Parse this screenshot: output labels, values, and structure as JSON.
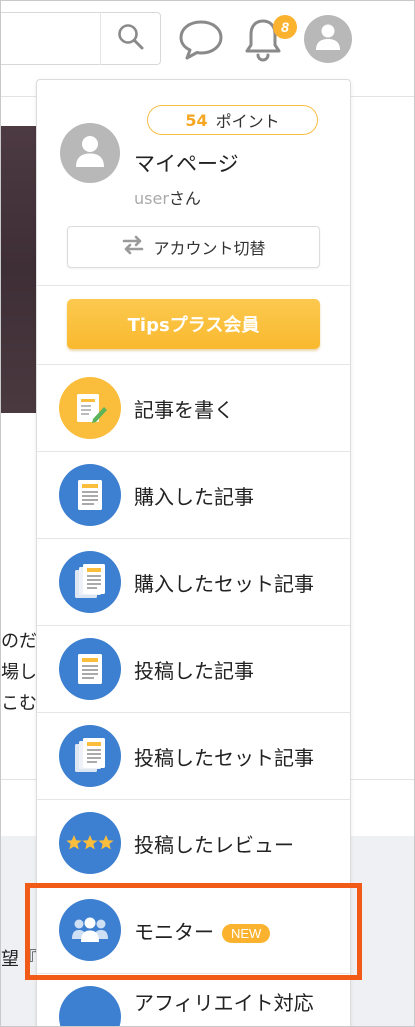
{
  "header": {
    "search_icon": "search-icon",
    "chat_icon": "chat-bubble-icon",
    "bell_icon": "bell-icon",
    "notification_count": "8",
    "avatar_icon": "user-avatar-icon"
  },
  "background": {
    "text_lines": [
      "のだ",
      "場しま",
      "こむ",
      "望『"
    ]
  },
  "dropdown": {
    "points_value": "54",
    "points_label": "ポイント",
    "mypage_label": "マイページ",
    "username": "user",
    "username_suffix": "さん",
    "switch_account_label": "アカウント切替",
    "tips_plus_label": "Tipsプラス会員",
    "menu": [
      {
        "label": "記事を書く",
        "icon": "write-article-icon",
        "color": "#fbbd3c"
      },
      {
        "label": "購入した記事",
        "icon": "document-icon",
        "color": "#3d7fd0"
      },
      {
        "label": "購入したセット記事",
        "icon": "document-set-icon",
        "color": "#3d7fd0"
      },
      {
        "label": "投稿した記事",
        "icon": "document-icon",
        "color": "#3d7fd0"
      },
      {
        "label": "投稿したセット記事",
        "icon": "document-set-icon",
        "color": "#3d7fd0"
      },
      {
        "label": "投稿したレビュー",
        "icon": "review-stars-icon",
        "color": "#3d7fd0"
      },
      {
        "label": "モニター",
        "icon": "monitor-users-icon",
        "color": "#3d7fd0",
        "badge": "NEW"
      },
      {
        "label": "アフィリエイト対応",
        "icon": "affiliate-icon",
        "color": "#3d7fd0"
      }
    ]
  },
  "colors": {
    "accent_yellow": "#fbb22e",
    "menu_blue": "#3d7fd0",
    "highlight_orange": "#f15a17"
  }
}
